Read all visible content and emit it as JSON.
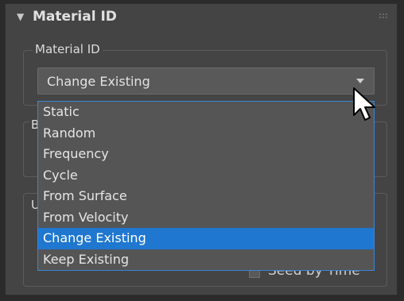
{
  "rollout": {
    "title": "Material ID"
  },
  "group": {
    "legend": "Material ID",
    "peek_b": "B",
    "peek_u": "U"
  },
  "dropdown": {
    "selected": "Change Existing",
    "options": [
      "Static",
      "Random",
      "Frequency",
      "Cycle",
      "From Surface",
      "From Velocity",
      "Change Existing",
      "Keep Existing"
    ],
    "highlighted_index": 6
  },
  "seed": {
    "label": "Seed by Time",
    "checked": false
  },
  "colors": {
    "panel_bg": "#444444",
    "highlight": "#1f77d0",
    "list_border": "#3a86d4"
  }
}
